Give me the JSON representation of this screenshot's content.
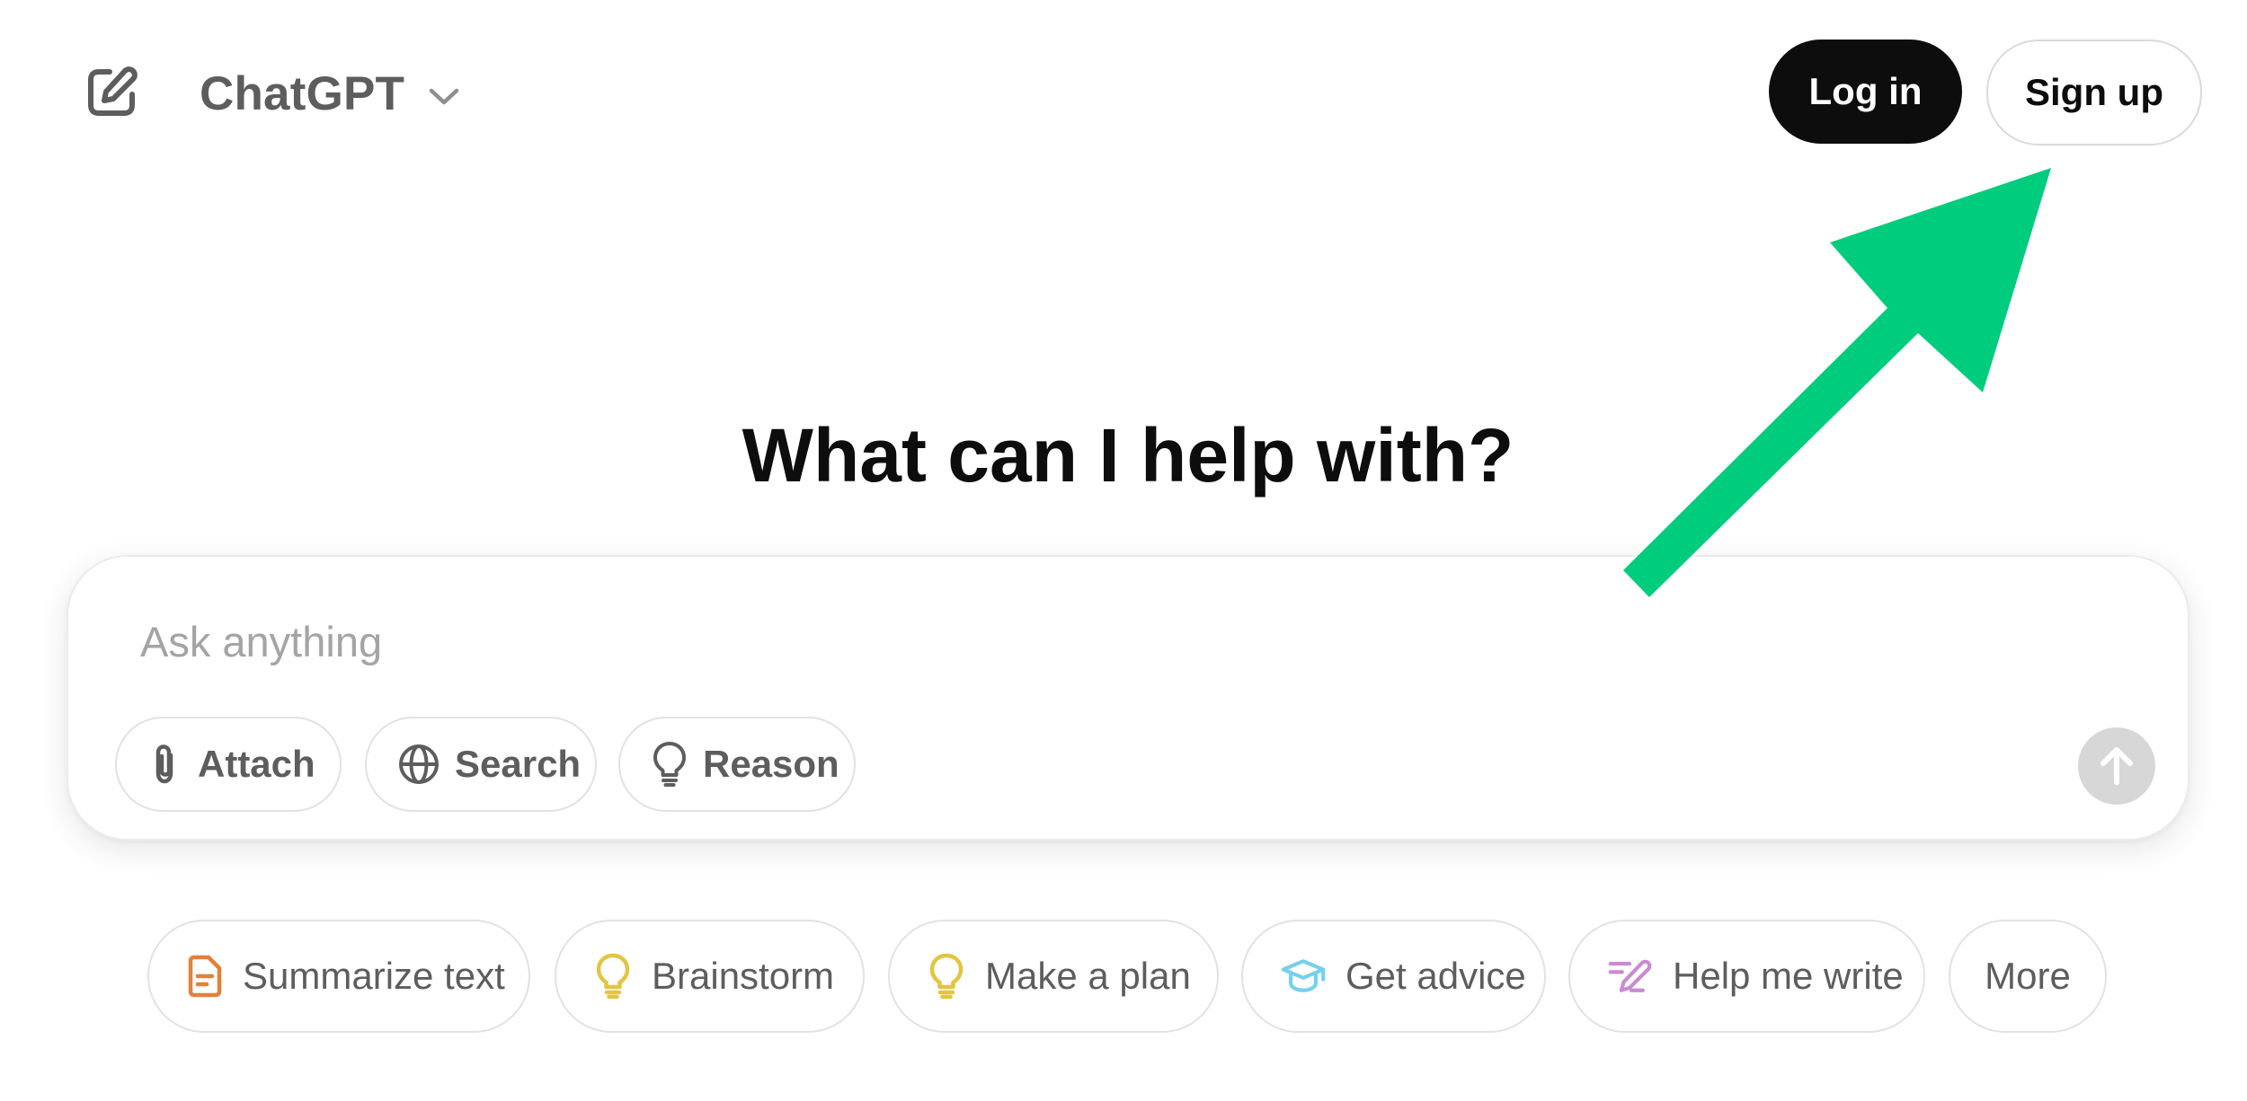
{
  "header": {
    "new_chat_icon": "edit-pencil-square-icon",
    "model_name": "ChatGPT",
    "model_chevron_icon": "chevron-down-icon",
    "login_label": "Log in",
    "signup_label": "Sign up"
  },
  "main": {
    "heading": "What can I help with?"
  },
  "composer": {
    "placeholder": "Ask anything",
    "value": "",
    "tools": [
      {
        "label": "Attach",
        "icon": "paperclip-icon"
      },
      {
        "label": "Search",
        "icon": "globe-icon"
      },
      {
        "label": "Reason",
        "icon": "lightbulb-icon"
      }
    ],
    "send_icon": "arrow-up-icon"
  },
  "suggestions": [
    {
      "label": "Summarize text",
      "icon": "document-icon",
      "color": "#e2813b"
    },
    {
      "label": "Brainstorm",
      "icon": "lightbulb-icon",
      "color": "#e2c541"
    },
    {
      "label": "Make a plan",
      "icon": "lightbulb-icon",
      "color": "#e2c541"
    },
    {
      "label": "Get advice",
      "icon": "graduation-cap-icon",
      "color": "#76d0eb"
    },
    {
      "label": "Help me write",
      "icon": "pen-lines-icon",
      "color": "#cb8bd0"
    },
    {
      "label": "More",
      "icon": "",
      "color": ""
    }
  ],
  "colors": {
    "login_bg": "#0d0d0d",
    "annotation_arrow": "#00cc7e",
    "send_disabled": "#d7d7d7"
  },
  "annotation": {
    "icon": "green-arrow-pointing-to-sign-up"
  }
}
